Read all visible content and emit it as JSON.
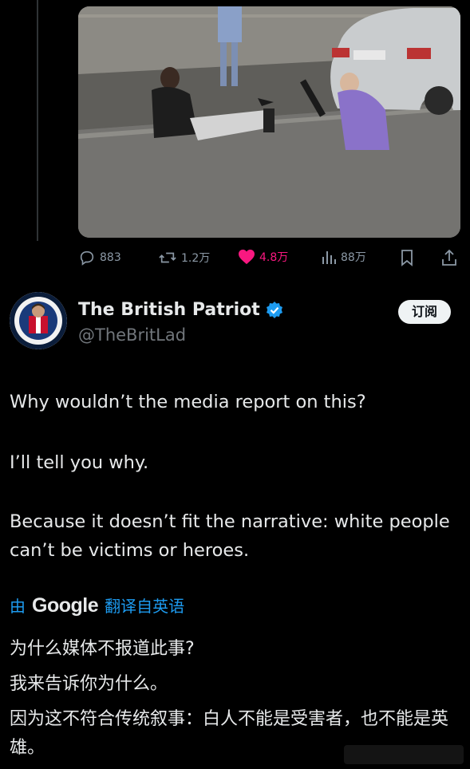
{
  "post": {
    "stats": {
      "replies": "883",
      "reposts": "1.2万",
      "likes": "4.8万",
      "views": "88万"
    }
  },
  "author": {
    "name": "The British Patriot",
    "handle": "@TheBritLad",
    "subscribe_label": "订阅",
    "verified_color": "#1d9bf0"
  },
  "tweet": {
    "line1": "Why wouldn’t the media report on this?",
    "line2": "I’ll tell you why.",
    "line3": "Because it doesn’t fit the narrative: white people can’t be victims or heroes."
  },
  "translation": {
    "prefix": "由",
    "provider": "Google",
    "suffix": "翻译自英语",
    "line1": "为什么媒体不报道此事?",
    "line2": "我来告诉你为什么。",
    "line3": "因为这不符合传统叙事：白人不能是受害者，也不能是英雄。"
  },
  "icons": {
    "reply": "reply-icon",
    "repost": "repost-icon",
    "like": "heart-icon",
    "views": "views-icon",
    "bookmark": "bookmark-icon",
    "share": "share-icon"
  },
  "colors": {
    "accent": "#1d9bf0",
    "like": "#f91880",
    "muted": "#8b98a5"
  }
}
